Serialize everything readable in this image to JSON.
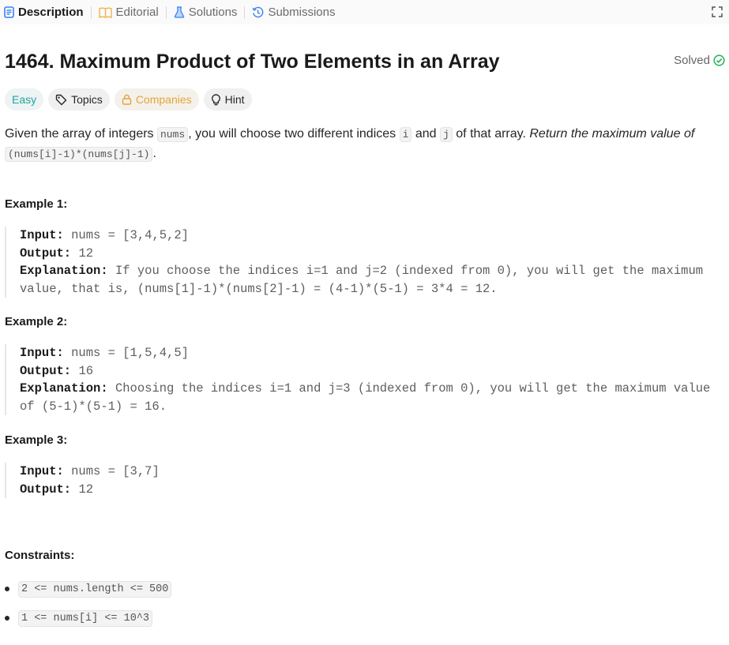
{
  "tabs": {
    "description": "Description",
    "editorial": "Editorial",
    "solutions": "Solutions",
    "submissions": "Submissions"
  },
  "problem": {
    "title": "1464. Maximum Product of Two Elements in an Array",
    "status": "Solved",
    "difficulty": "Easy",
    "topics": "Topics",
    "companies": "Companies",
    "hint": "Hint"
  },
  "description": {
    "t1": "Given the array of integers ",
    "c_nums": "nums",
    "t2": ", you will choose two different indices ",
    "c_i": "i",
    "t3": " and ",
    "c_j": "j",
    "t4": " of that array. ",
    "t5": "Return the maximum value of",
    "c_expr": "(nums[i]-1)*(nums[j]-1)",
    "t6": "."
  },
  "examples": [
    {
      "heading": "Example 1:",
      "input_label": "Input:",
      "input": "nums = [3,4,5,2]",
      "output_label": "Output:",
      "output": "12",
      "explanation_label": "Explanation:",
      "explanation_1": "If you choose the indices i=1 and j=2 (indexed from 0), you will get the maximum",
      "explanation_2": "value, that is, (nums[1]-1)*(nums[2]-1) = (4-1)*(5-1) = 3*4 = 12."
    },
    {
      "heading": "Example 2:",
      "input_label": "Input:",
      "input": "nums = [1,5,4,5]",
      "output_label": "Output:",
      "output": "16",
      "explanation_label": "Explanation:",
      "explanation_1": "Choosing the indices i=1 and j=3 (indexed from 0), you will get the maximum value",
      "explanation_2": "of (5-1)*(5-1) = 16."
    },
    {
      "heading": "Example 3:",
      "input_label": "Input:",
      "input": "nums = [3,7]",
      "output_label": "Output:",
      "output": "12"
    }
  ],
  "constraints": {
    "heading": "Constraints:",
    "items": [
      "2 <= nums.length <= 500",
      "1 <= nums[i] <= 10^3"
    ]
  },
  "colors": {
    "accent_blue": "#3b82f6",
    "easy": "#1fa4a0",
    "companies": "#e8a23a",
    "solved_check": "#2db55d"
  }
}
